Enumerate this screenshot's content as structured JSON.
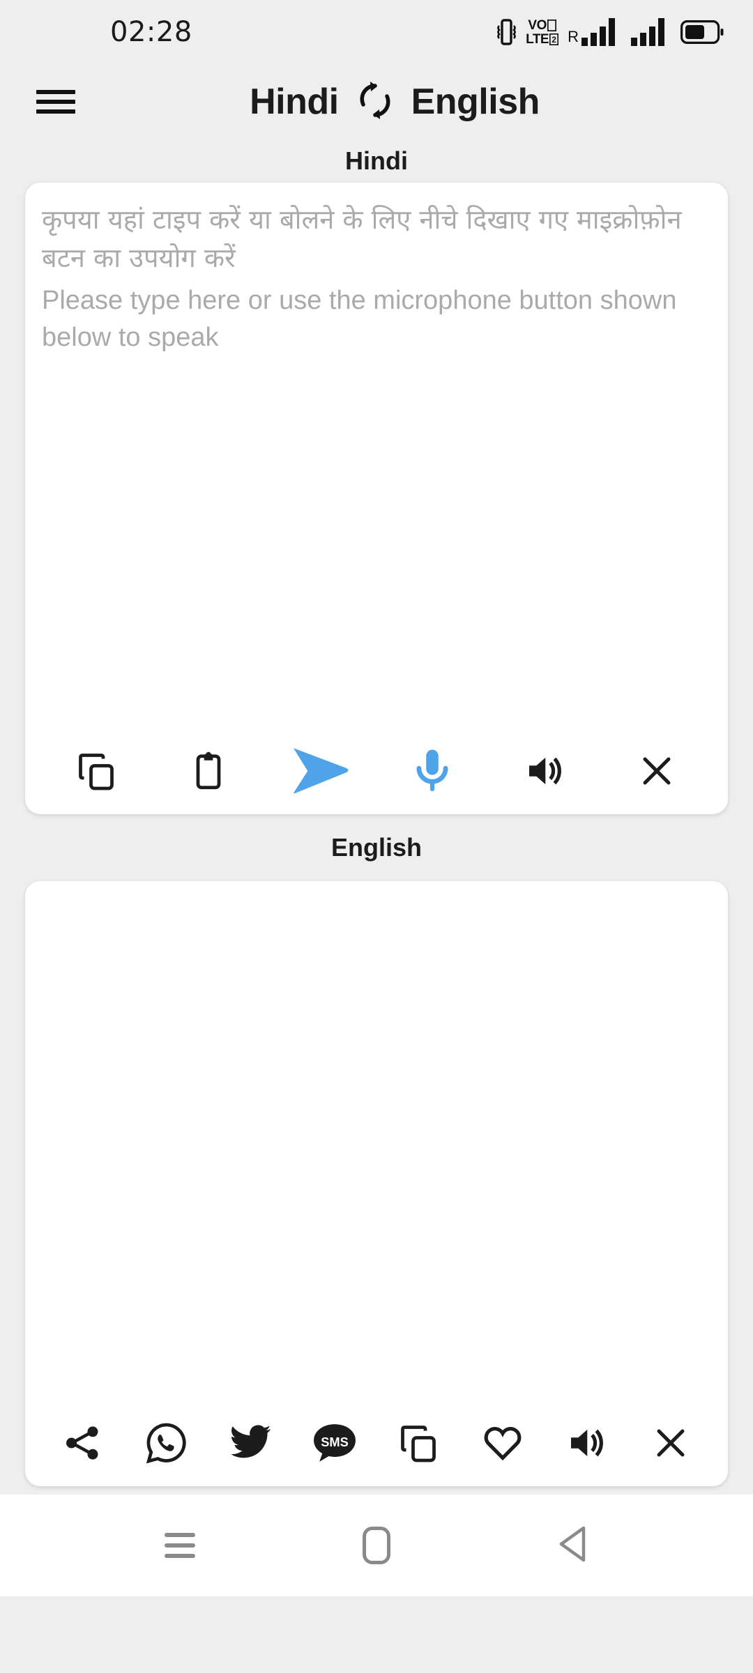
{
  "status_bar": {
    "time": "02:28",
    "icons": [
      "vibrate-icon",
      "volte-icon",
      "signal-roaming-icon",
      "signal-icon",
      "battery-icon"
    ],
    "volte_line1": "VO",
    "volte_line2": "LTE",
    "volte_sim": "2",
    "roaming_letter": "R"
  },
  "app_bar": {
    "menu_icon": "hamburger-menu-icon",
    "source_language": "Hindi",
    "swap_icon": "swap-languages-icon",
    "target_language": "English"
  },
  "source_panel": {
    "label": "Hindi",
    "placeholder_native": "कृपया यहां टाइप करें या बोलने के लिए नीचे दिखाए गए माइक्रोफ़ोन बटन का उपयोग करें",
    "placeholder_english": "Please type here or use the microphone button shown below to speak",
    "value": "",
    "toolbar": [
      {
        "name": "copy-button",
        "icon": "copy-icon",
        "color": "#1c1c1c"
      },
      {
        "name": "paste-button",
        "icon": "clipboard-paste-icon",
        "color": "#1c1c1c"
      },
      {
        "name": "translate-send-button",
        "icon": "send-arrow-icon",
        "color": "#4FA3E8"
      },
      {
        "name": "microphone-button",
        "icon": "microphone-icon",
        "color": "#4FA3E8"
      },
      {
        "name": "speak-button",
        "icon": "speaker-icon",
        "color": "#1c1c1c"
      },
      {
        "name": "clear-button",
        "icon": "close-icon",
        "color": "#1c1c1c"
      }
    ]
  },
  "target_panel": {
    "label": "English",
    "value": "",
    "toolbar": [
      {
        "name": "share-button",
        "icon": "share-icon"
      },
      {
        "name": "whatsapp-button",
        "icon": "whatsapp-icon"
      },
      {
        "name": "twitter-button",
        "icon": "twitter-icon"
      },
      {
        "name": "sms-button",
        "icon": "sms-icon",
        "glyph": "SMS"
      },
      {
        "name": "copy-button",
        "icon": "copy-icon"
      },
      {
        "name": "favorite-button",
        "icon": "heart-icon"
      },
      {
        "name": "speak-button",
        "icon": "speaker-icon"
      },
      {
        "name": "clear-button",
        "icon": "close-icon"
      }
    ]
  },
  "nav_bar": {
    "recents": "recents-icon",
    "home": "home-icon",
    "back": "back-icon"
  },
  "colors": {
    "background": "#eeeeee",
    "card": "#ffffff",
    "accent": "#4FA3E8",
    "text": "#1c1c1c",
    "placeholder": "#aaaaaa",
    "nav_icon": "#8a8a8a"
  }
}
